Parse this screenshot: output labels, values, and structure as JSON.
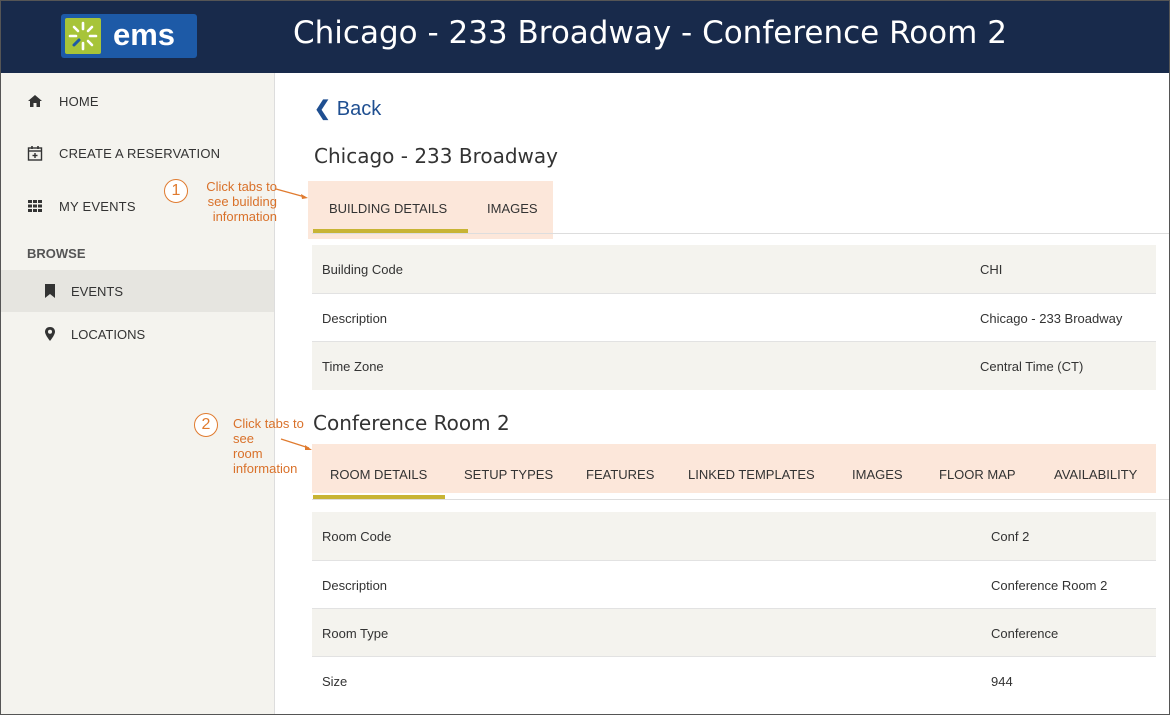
{
  "header": {
    "logo_text": "ems",
    "title": "Chicago - 233 Broadway - Conference Room 2",
    "bg_color": "#182a4b",
    "logo_bg": "#1d5aa7",
    "logo_mark_color": "#a7c439"
  },
  "sidebar": {
    "items": [
      {
        "label": "HOME",
        "icon": "home-icon"
      },
      {
        "label": "CREATE A RESERVATION",
        "icon": "calendar-plus-icon"
      },
      {
        "label": "MY EVENTS",
        "icon": "grid-icon"
      }
    ],
    "browse_label": "BROWSE",
    "browse_items": [
      {
        "label": "EVENTS",
        "icon": "bookmark-icon",
        "active": true
      },
      {
        "label": "LOCATIONS",
        "icon": "map-pin-icon",
        "active": false
      }
    ]
  },
  "main": {
    "back_label": "Back",
    "building": {
      "title": "Chicago - 233 Broadway",
      "tabs": [
        {
          "label": "BUILDING DETAILS",
          "active": true
        },
        {
          "label": "IMAGES",
          "active": false
        }
      ],
      "rows": [
        {
          "key": "Building Code",
          "value": "CHI"
        },
        {
          "key": "Description",
          "value": "Chicago - 233 Broadway"
        },
        {
          "key": "Time Zone",
          "value": "Central Time (CT)"
        }
      ]
    },
    "room": {
      "title": "Conference Room 2",
      "tabs": [
        {
          "label": "ROOM DETAILS",
          "active": true
        },
        {
          "label": "SETUP TYPES",
          "active": false
        },
        {
          "label": "FEATURES",
          "active": false
        },
        {
          "label": "LINKED TEMPLATES",
          "active": false
        },
        {
          "label": "IMAGES",
          "active": false
        },
        {
          "label": "FLOOR MAP",
          "active": false
        },
        {
          "label": "AVAILABILITY",
          "active": false
        }
      ],
      "rows": [
        {
          "key": "Room Code",
          "value": "Conf 2"
        },
        {
          "key": "Description",
          "value": "Conference Room 2"
        },
        {
          "key": "Room Type",
          "value": "Conference"
        },
        {
          "key": "Size",
          "value": "944"
        }
      ]
    }
  },
  "annotations": [
    {
      "number": "1",
      "lines": [
        "Click tabs to",
        "see building",
        "information"
      ]
    },
    {
      "number": "2",
      "lines": [
        "Click tabs to",
        "see",
        "room",
        "information"
      ]
    }
  ],
  "colors": {
    "accent_tab_underline": "#c8b434",
    "annotation": "#e07b2f",
    "tab_highlight": "#fce7da",
    "link": "#1f4f91"
  }
}
